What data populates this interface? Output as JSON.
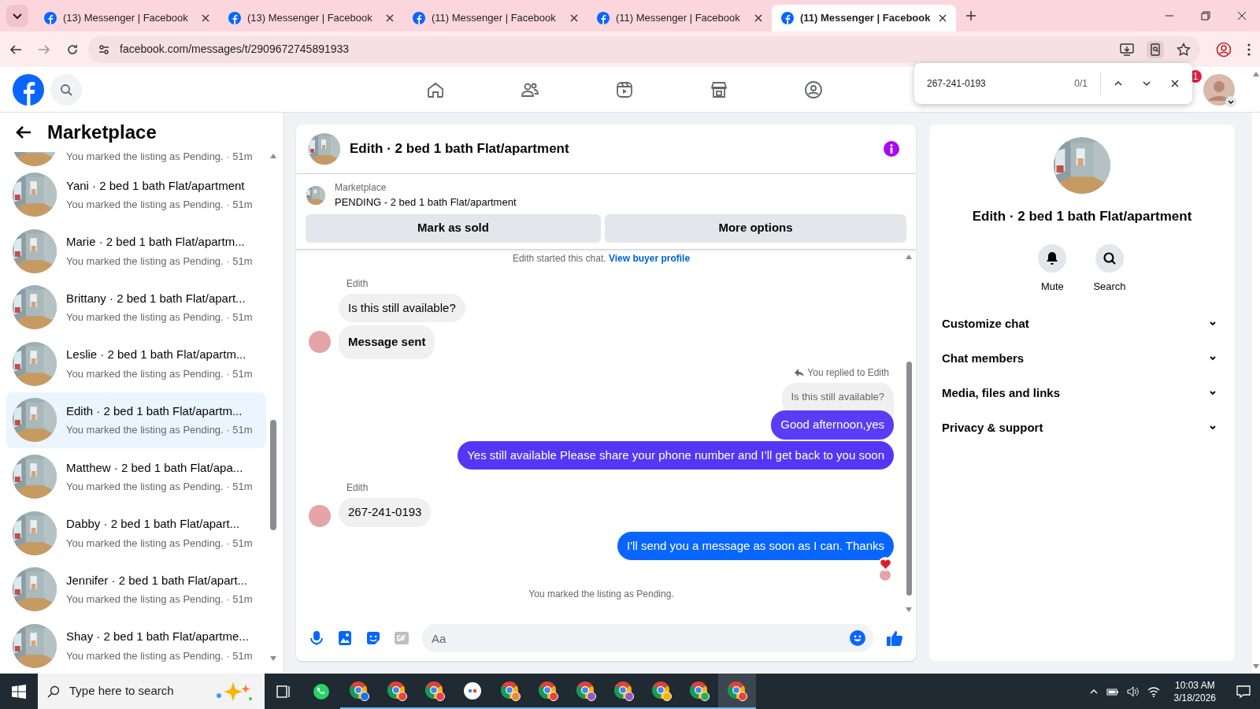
{
  "browser": {
    "tabs": [
      {
        "title": "(13) Messenger | Facebook",
        "selected": false
      },
      {
        "title": "(13) Messenger | Facebook",
        "selected": false
      },
      {
        "title": "(11) Messenger | Facebook",
        "selected": false
      },
      {
        "title": "(11) Messenger | Facebook",
        "selected": false
      },
      {
        "title": "(11) Messenger | Facebook",
        "selected": true
      }
    ],
    "url": "facebook.com/messages/t/2909672745891933",
    "find_bar": {
      "query": "267-241-0193",
      "count": "0/1"
    }
  },
  "header": {
    "notification_badge": "1"
  },
  "sidebar": {
    "title": "Marketplace",
    "items": [
      {
        "subtitle": "You marked the listing as Pending. · 51m",
        "selected": false
      },
      {
        "title": "Yani · 2 bed 1 bath Flat/apartment",
        "subtitle": "You marked the listing as Pending. · 51m",
        "selected": false
      },
      {
        "title": "Marie · 2 bed 1 bath Flat/apartm...",
        "subtitle": "You marked the listing as Pending. · 51m",
        "selected": false
      },
      {
        "title": "Brittany · 2 bed 1 bath Flat/apart...",
        "subtitle": "You marked the listing as Pending. · 51m",
        "selected": false
      },
      {
        "title": "Leslie · 2 bed 1 bath Flat/apartm...",
        "subtitle": "You marked the listing as Pending. · 51m",
        "selected": false
      },
      {
        "title": "Edith · 2 bed 1 bath Flat/apartm...",
        "subtitle": "You marked the listing as Pending. · 51m",
        "selected": true
      },
      {
        "title": "Matthew · 2 bed 1 bath Flat/apa...",
        "subtitle": "You marked the listing as Pending. · 51m",
        "selected": false
      },
      {
        "title": "Dabby · 2 bed 1 bath Flat/apart...",
        "subtitle": "You marked the listing as Pending. · 51m",
        "selected": false
      },
      {
        "title": "Jennifer · 2 bed 1 bath Flat/apart...",
        "subtitle": "You marked the listing as Pending. · 51m",
        "selected": false
      },
      {
        "title": "Shay · 2 bed 1 bath Flat/apartme...",
        "subtitle": "You marked the listing as Pending. · 51m",
        "selected": false
      }
    ]
  },
  "chat": {
    "title": "Edith · 2 bed 1 bath Flat/apartment",
    "listing": {
      "source": "Marketplace",
      "name": "PENDING - 2 bed 1 bath Flat/apartment",
      "buttons": [
        "Mark as sold",
        "More options"
      ]
    },
    "messages": [
      {
        "kind": "system",
        "text": "Edith started this chat.",
        "link": "View buyer profile"
      },
      {
        "kind": "sender",
        "text": "Edith"
      },
      {
        "kind": "incoming",
        "text": "Is this still available?",
        "avatar": false
      },
      {
        "kind": "incoming",
        "text": "Message sent",
        "avatar": true
      },
      {
        "kind": "reply_note",
        "text": "You replied to Edith"
      },
      {
        "kind": "quoted",
        "text": "Is this still available?"
      },
      {
        "kind": "outgoing",
        "text": "Good afternoon,yes",
        "color": "#5b3cf6",
        "reaction": false
      },
      {
        "kind": "outgoing",
        "text": "Yes still available Please share your phone number and I’ll get back to you soon",
        "color": "#5536f4",
        "reaction": false
      },
      {
        "kind": "sender",
        "text": "Edith"
      },
      {
        "kind": "incoming",
        "text": "267-241-0193",
        "avatar": true
      },
      {
        "kind": "outgoing",
        "text": "I'll send you a message as soon as I can. Thanks",
        "color": "#0866ff",
        "reaction": true
      },
      {
        "kind": "seen"
      },
      {
        "kind": "system",
        "text": "You marked the listing as Pending."
      }
    ],
    "composer": {
      "placeholder": "Aa"
    }
  },
  "details": {
    "title": "Edith · 2 bed 1 bath Flat/apartment",
    "actions": [
      "Mute",
      "Search"
    ],
    "sections": [
      {
        "label": "Customize chat",
        "expanded": false
      },
      {
        "label": "Chat members",
        "expanded": false
      },
      {
        "label": "Media, files and links",
        "expanded": false
      },
      {
        "label": "Privacy & support",
        "expanded": false
      }
    ]
  },
  "taskbar": {
    "search_placeholder": "Type here to search",
    "time": "10:03 AM",
    "date": "3/18/2026"
  }
}
